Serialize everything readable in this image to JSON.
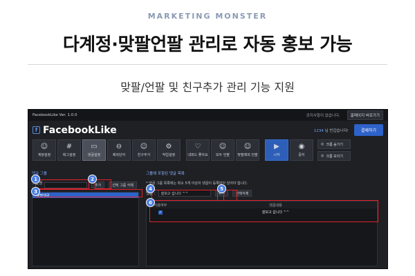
{
  "brand": "MARKETING MONSTER",
  "headline": "다계정·맞팔언팔 관리로 자동 홍보 가능",
  "subline": "맞팔/언팔 및 친구추가 관리 기능 지원",
  "app": {
    "window_title": "FacebookLike Ver. 1.0.0",
    "notice": "공지사항이 없습니다.",
    "home_button": "홈페이지 바로가기",
    "logo": "FacebookLike",
    "user_id": "1234",
    "welcome": "님 반갑습니다!",
    "pay_button": "결제하기",
    "toolbar": [
      {
        "label": "계정설정",
        "icon": "person-icon",
        "glyph": "☺",
        "active": false
      },
      {
        "label": "태그설정",
        "icon": "hashtag-icon",
        "glyph": "#",
        "active": false
      },
      {
        "label": "댓글설정",
        "icon": "comment-icon",
        "glyph": "▭",
        "active": true
      },
      {
        "label": "제외단어",
        "icon": "minus-circle-icon",
        "glyph": "⊖",
        "active": false
      },
      {
        "label": "친구추가",
        "icon": "add-friend-icon",
        "glyph": "☺",
        "active": false
      },
      {
        "label": "작업설정",
        "icon": "gear-icon",
        "glyph": "⚙",
        "active": false
      },
      {
        "label": "내피드 좋아요",
        "icon": "heart-icon",
        "glyph": "♡",
        "active": false
      },
      {
        "label": "모두 언팔",
        "icon": "remove-user-icon",
        "glyph": "☺",
        "active": false
      },
      {
        "label": "맞팔제외 언팔",
        "icon": "remove-user-icon",
        "glyph": "☺",
        "active": false
      }
    ],
    "start_label": "시작",
    "stop_label": "중지",
    "hide_chrome": "크롬 숨기기",
    "show_chrome": "크롬 보이기",
    "left": {
      "title": "댓글 그룹",
      "group_label": "그룹명 :",
      "add_button": "추가",
      "delete_button": "선택 그룹 삭제",
      "groups": [
        "맞팔댓글"
      ]
    },
    "right": {
      "title": "그룹에 포함된 댓글 목록",
      "note": "* 댓글 그룹 목록에는 최소 5개 이상의 댓글이 등록되어 있어야 합니다.",
      "comment_label": "댓글 :",
      "comment_value": "잘보고 갑니다 ^^",
      "add_button": "추가",
      "delete_button": "선택삭제",
      "col_use": "사용여부",
      "col_content": "댓글내용",
      "rows": [
        {
          "used": true,
          "content": "잘보고 갑니다 ^^"
        }
      ]
    }
  },
  "badges": [
    "1",
    "2",
    "3",
    "4",
    "5",
    "6"
  ]
}
